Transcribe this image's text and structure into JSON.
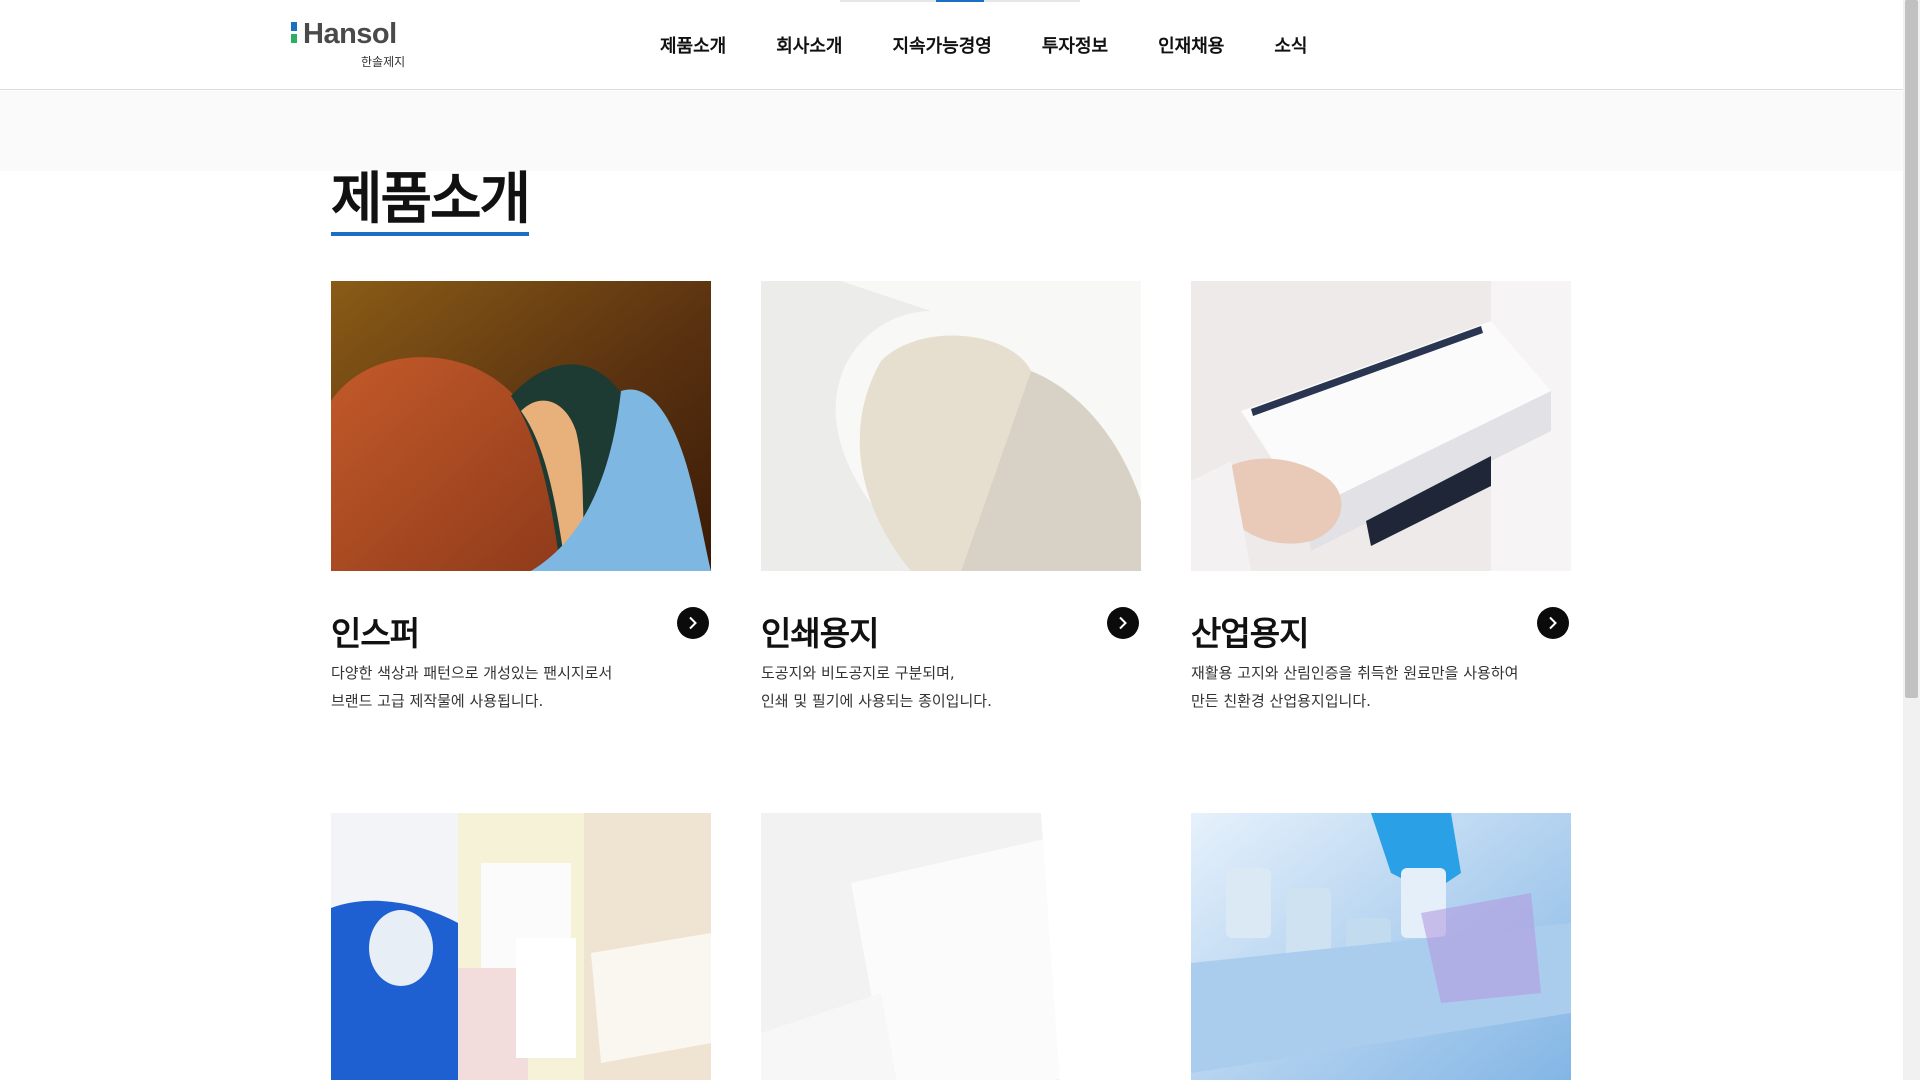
{
  "brand": {
    "name": "Hansol",
    "sub": "한솔제지"
  },
  "nav": {
    "items": [
      {
        "label": "제품소개"
      },
      {
        "label": "회사소개"
      },
      {
        "label": "지속가능경영"
      },
      {
        "label": "투자정보"
      },
      {
        "label": "인재채용"
      },
      {
        "label": "소식"
      }
    ]
  },
  "main": {
    "title": "제품소개",
    "cards": [
      {
        "title": "인스퍼",
        "desc": [
          "다양한 색상과 패턴으로 개성있는 팬시지로서",
          "브랜드 고급 제작물에 사용됩니다."
        ]
      },
      {
        "title": "인쇄용지",
        "desc": [
          "도공지와 비도공지로 구분되며,",
          "인쇄 및 필기에 사용되는 종이입니다."
        ]
      },
      {
        "title": "산업용지",
        "desc": [
          "재활용 고지와 산림인증을 취득한 원료만을 사용하여",
          "만든 친환경 산업용지입니다."
        ]
      }
    ]
  },
  "colors": {
    "accent": "#1a6fc4",
    "logo_green": "#2bae66",
    "text": "#111111"
  },
  "icons": [
    "chevron-right-icon"
  ]
}
